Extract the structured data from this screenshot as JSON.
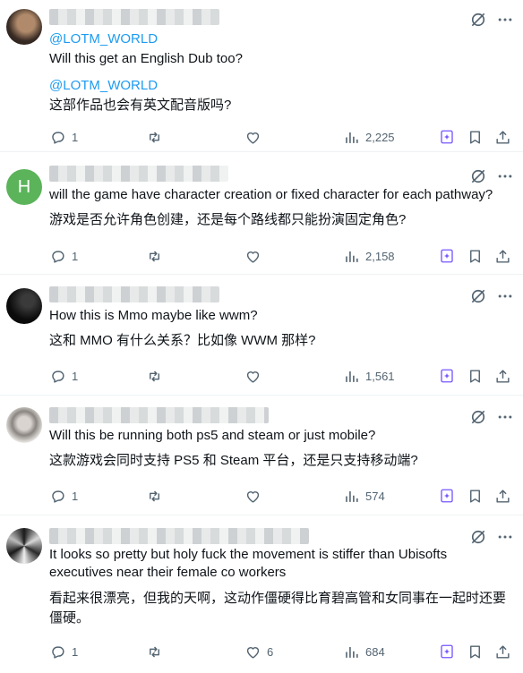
{
  "posts": [
    {
      "mention": "@LOTM_WORLD",
      "text_en": "Will this get an English Dub too?",
      "mention2": "@LOTM_WORLD",
      "text_zh": "这部作品也会有英文配音版吗?",
      "replies": "1",
      "likes": "",
      "views": "2,225"
    },
    {
      "text_en": "will the game have character creation or fixed character for each pathway?",
      "text_zh": "游戏是否允许角色创建，还是每个路线都只能扮演固定角色?",
      "replies": "1",
      "likes": "",
      "views": "2,158"
    },
    {
      "text_en": "How this is Mmo maybe like wwm?",
      "text_zh": "这和 MMO 有什么关系？比如像 WWM 那样?",
      "replies": "1",
      "likes": "",
      "views": "1,561"
    },
    {
      "text_en": "Will this be running both ps5 and steam or just mobile?",
      "text_zh": "这款游戏会同时支持 PS5 和 Steam 平台，还是只支持移动端?",
      "replies": "1",
      "likes": "",
      "views": "574"
    },
    {
      "text_en": "It looks so pretty but holy fuck the movement is stiffer than Ubisofts executives near their female co workers",
      "text_zh": "看起来很漂亮，但我的天啊，这动作僵硬得比育碧高管和女同事在一起时还要僵硬。",
      "replies": "1",
      "likes": "6",
      "views": "684"
    }
  ],
  "avatar_letter": "H",
  "colors": {
    "mention": "#1d9bf0",
    "icon": "#536471",
    "grok": "#7856ff",
    "avatar_green": "#5bb35a"
  }
}
